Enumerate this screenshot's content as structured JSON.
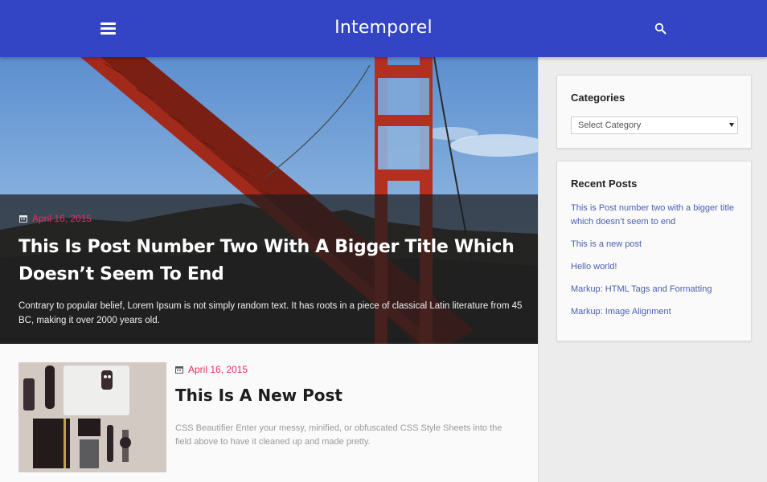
{
  "header": {
    "site_title": "Intemporel",
    "menu_icon": "hamburger-icon",
    "search_icon": "search-icon",
    "background_color": "#3344c4"
  },
  "featured_post": {
    "date": "April 16, 2015",
    "title": "This Is Post Number Two With A Bigger Title Which Doesn’t Seem To End",
    "excerpt": "Contrary to popular belief, Lorem Ipsum is not simply random text. It has roots in a piece of classical Latin literature from 45 BC, making it over 2000 years old.",
    "image": "golden-gate-bridge-photo"
  },
  "posts": [
    {
      "date": "April 16, 2015",
      "title": "This Is A New Post",
      "excerpt": "CSS Beautifier Enter your messy, minified, or obfuscated CSS Style Sheets into the field above to have it cleaned up and made pretty.",
      "image": "desk-flatlay-photo"
    }
  ],
  "sidebar": {
    "categories": {
      "title": "Categories",
      "select_value": "Select Category"
    },
    "recent_posts": {
      "title": "Recent Posts",
      "items": [
        {
          "label": "This is Post number two with a bigger title which doesn’t seem to end"
        },
        {
          "label": "This is a new post"
        },
        {
          "label": "Hello world!"
        },
        {
          "label": "Markup: HTML Tags and Formatting"
        },
        {
          "label": "Markup: Image Alignment"
        }
      ]
    }
  },
  "colors": {
    "accent": "#ee2a5f",
    "link": "#4a5fb5"
  }
}
